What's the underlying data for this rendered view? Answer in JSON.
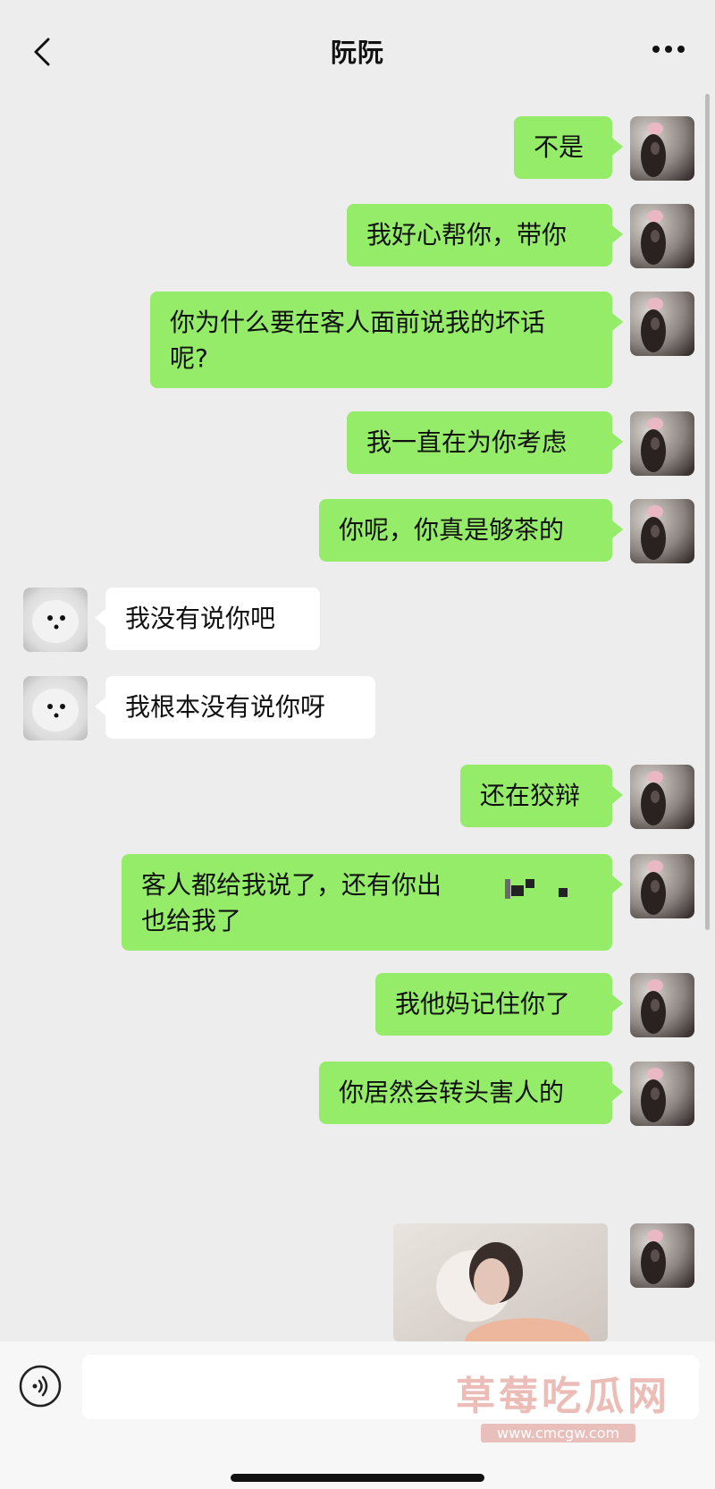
{
  "header": {
    "title": "阮阮"
  },
  "messages": [
    {
      "side": "me",
      "text": "不是"
    },
    {
      "side": "me",
      "text": "我好心帮你，带你"
    },
    {
      "side": "me",
      "text": "你为什么要在客人面前说我的坏话\n呢?"
    },
    {
      "side": "me",
      "text": "我一直在为你考虑"
    },
    {
      "side": "me",
      "text": "你呢，你真是够茶的"
    },
    {
      "side": "them",
      "text": "我没有说你吧"
    },
    {
      "side": "them",
      "text": "我根本没有说你呀"
    },
    {
      "side": "me",
      "text": "还在狡辩"
    },
    {
      "side": "me",
      "text": "客人都给我说了，还有你出\n也给我了"
    },
    {
      "side": "me",
      "text": "我他妈记住你了"
    },
    {
      "side": "me",
      "text": "你居然会转头害人的"
    },
    {
      "side": "me",
      "type": "image"
    }
  ],
  "watermark": {
    "text": "草莓吃瓜网",
    "url": "www.cmcgw.com"
  },
  "colors": {
    "background": "#ededed",
    "my_bubble": "#95ec69",
    "their_bubble": "#ffffff"
  },
  "icons": {
    "back": "chevron-left-icon",
    "more": "more-dots-icon",
    "voice": "voice-input-icon"
  }
}
